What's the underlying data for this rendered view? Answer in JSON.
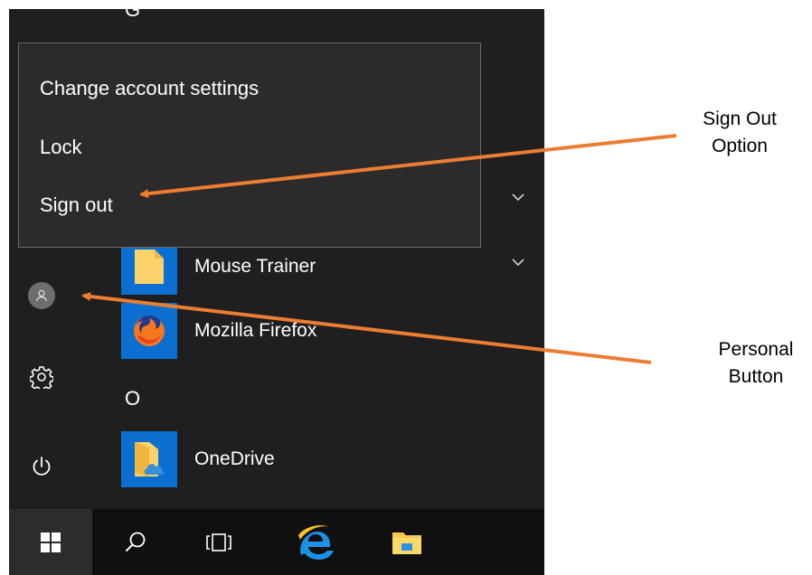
{
  "account_menu": {
    "items": [
      {
        "label": "Change account settings"
      },
      {
        "label": "Lock"
      },
      {
        "label": "Sign out"
      }
    ]
  },
  "apps": [
    {
      "label": "Mouse Trainer",
      "icon": "folder-icon"
    },
    {
      "label": "Mozilla Firefox",
      "icon": "firefox-icon"
    },
    {
      "label": "OneDrive",
      "icon": "onedrive-folder-icon"
    }
  ],
  "section_letters": {
    "top_partial": "G",
    "o": "O"
  },
  "rail": {
    "account": "user-icon",
    "settings": "gear-icon",
    "power": "power-icon"
  },
  "taskbar": {
    "items": [
      "windows-logo-icon",
      "search-icon",
      "task-view-icon",
      "internet-explorer-icon",
      "file-explorer-icon"
    ]
  },
  "annotations": {
    "sign_out": [
      "Sign Out",
      "Option"
    ],
    "personal": [
      "Personal",
      "Button"
    ]
  },
  "colors": {
    "annotation_arrow": "#ed7d31",
    "tile_blue": "#0a6fd1",
    "menu_background": "#1f1f1f",
    "popup_background": "#2b2b2b"
  }
}
